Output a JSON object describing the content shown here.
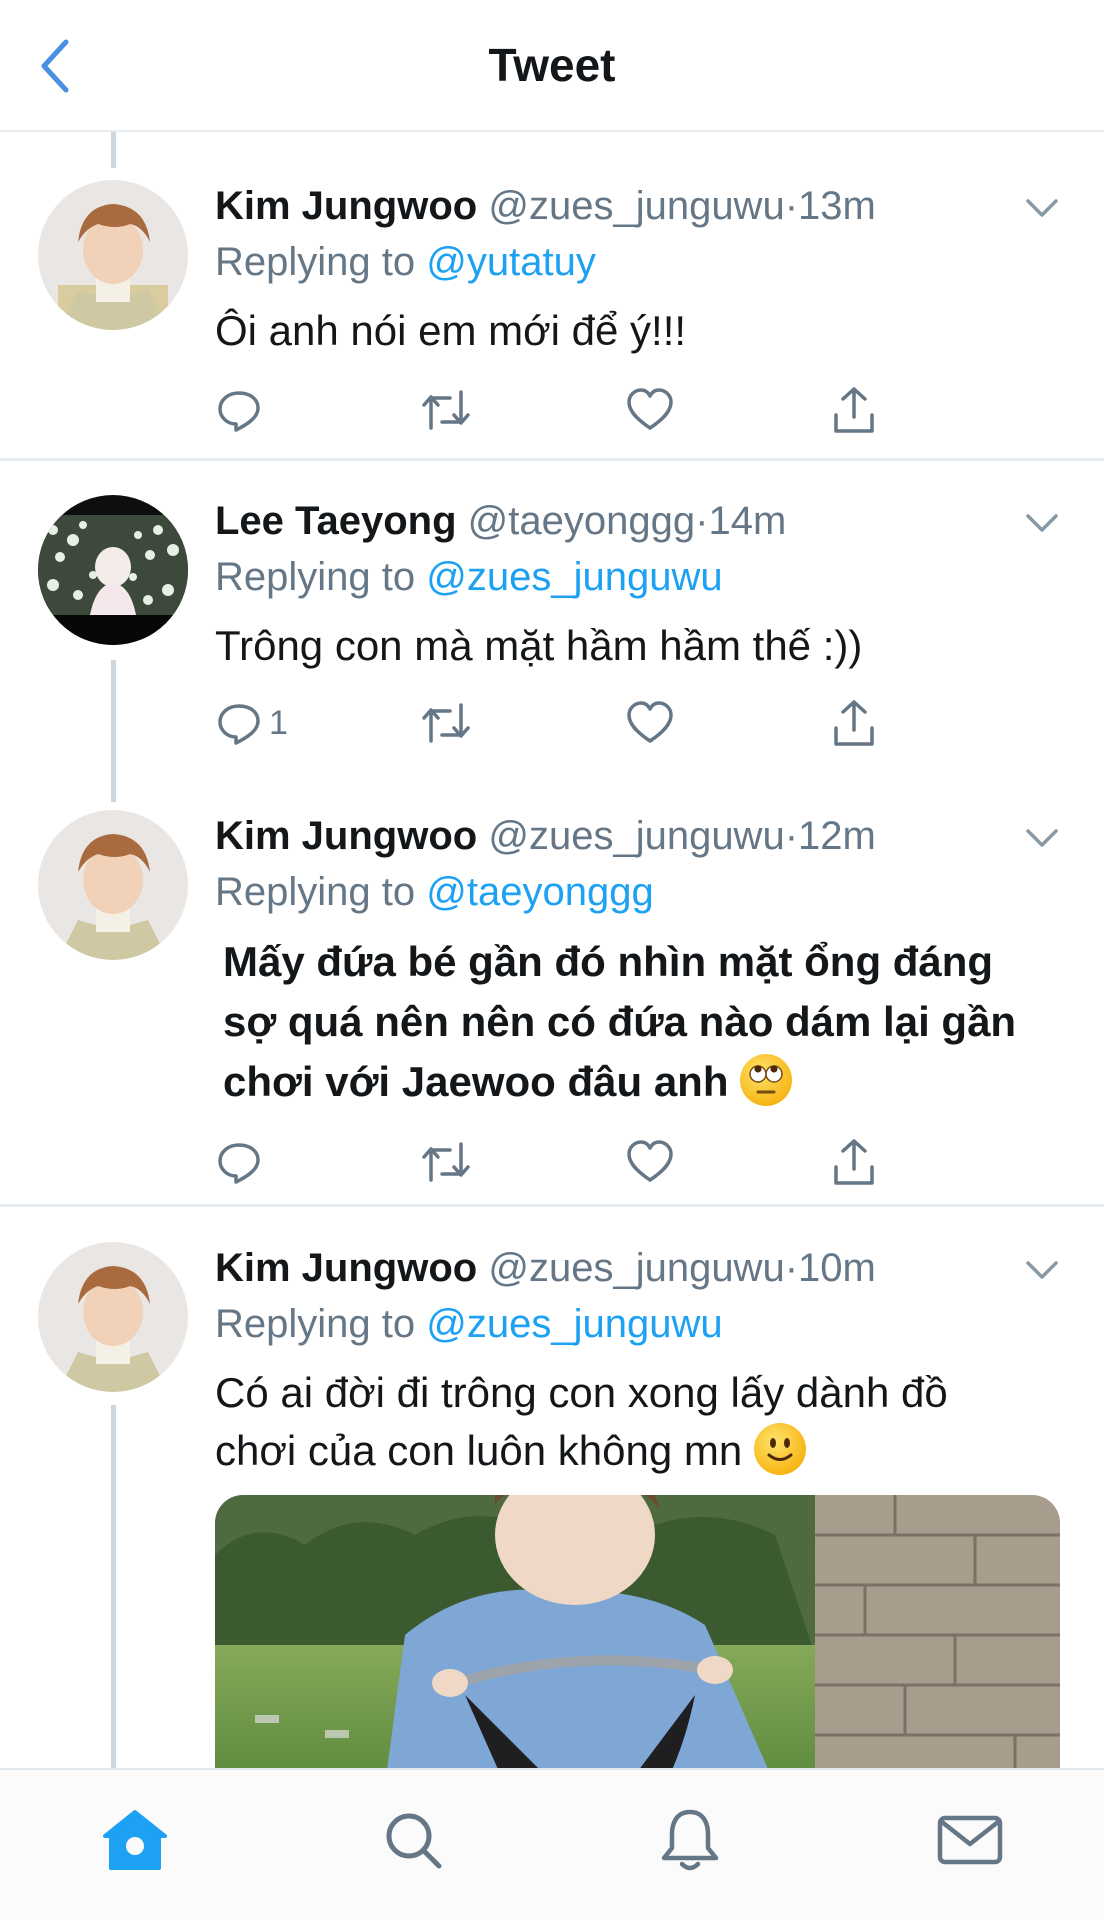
{
  "nav": {
    "title": "Tweet",
    "back_icon": "chevron-left-icon"
  },
  "colors": {
    "accent": "#1da1f2",
    "nav_accent": "#4a90e2",
    "text": "#14171a",
    "muted": "#657786",
    "divider": "#e6ecf0"
  },
  "tweets": [
    {
      "name": "Kim Jungwoo",
      "handle": "@zues_junguwu",
      "dot": "·",
      "time": "13m",
      "replying_prefix": "Replying to",
      "replying_handle": "@yutatuy",
      "text": "Ôi anh nói em mới để ý!!!",
      "reply_count": ""
    },
    {
      "name": "Lee Taeyong",
      "handle": "@taeyonggg",
      "dot": "·",
      "time": "14m",
      "replying_prefix": "Replying to",
      "replying_handle": "@zues_junguwu",
      "text": "Trông con mà mặt hầm hầm thế :))",
      "reply_count": "1"
    },
    {
      "name": "Kim Jungwoo",
      "handle": "@zues_junguwu",
      "dot": "·",
      "time": "12m",
      "replying_prefix": "Replying to",
      "replying_handle": "@taeyonggg",
      "text_line1": "Mấy đứa bé gần đó nhìn mặt ổng đáng",
      "text_line2": "sợ quá nên nên có đứa nào dám lại gần",
      "text_line3": "chơi với Jaewoo đâu anh",
      "emoji": "face-with-rolling-eyes",
      "reply_count": ""
    },
    {
      "name": "Kim Jungwoo",
      "handle": "@zues_junguwu",
      "dot": "·",
      "time": "10m",
      "replying_prefix": "Replying to",
      "replying_handle": "@zues_junguwu",
      "text_line1": "Có ai đời đi trông con xong lấy dành đồ",
      "text_line2": "chơi của con luôn không mn",
      "emoji": "slightly-smiling-face",
      "reply_count": ""
    }
  ],
  "tabbar": {
    "items": [
      "home-icon",
      "search-icon",
      "notifications-icon",
      "messages-icon"
    ],
    "active": "home-icon"
  }
}
